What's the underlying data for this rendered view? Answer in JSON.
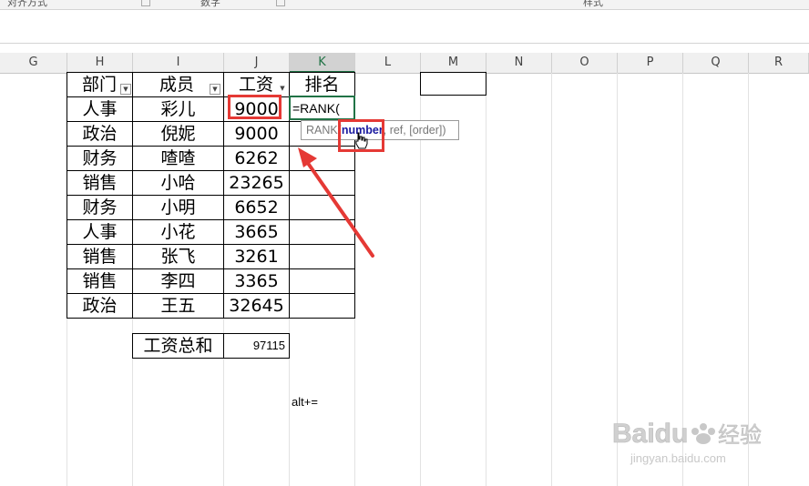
{
  "ribbon": {
    "alignment_label": "对齐方式",
    "number_label": "数字",
    "styles_label": "样式"
  },
  "columns": [
    "G",
    "H",
    "I",
    "J",
    "K",
    "L",
    "M",
    "N",
    "O",
    "P",
    "Q",
    "R"
  ],
  "table": {
    "headers": {
      "dept": "部门",
      "member": "成员",
      "salary": "工资",
      "rank": "排名"
    },
    "rows": [
      {
        "dept": "人事",
        "member": "彩儿",
        "salary": "9000"
      },
      {
        "dept": "政治",
        "member": "倪妮",
        "salary": "9000"
      },
      {
        "dept": "财务",
        "member": "喳喳",
        "salary": "6262"
      },
      {
        "dept": "销售",
        "member": "小哈",
        "salary": "23265"
      },
      {
        "dept": "财务",
        "member": "小明",
        "salary": "6652"
      },
      {
        "dept": "人事",
        "member": "小花",
        "salary": "3665"
      },
      {
        "dept": "销售",
        "member": "张飞",
        "salary": "3261"
      },
      {
        "dept": "销售",
        "member": "李四",
        "salary": "3365"
      },
      {
        "dept": "政治",
        "member": "王五",
        "salary": "32645"
      }
    ]
  },
  "active_cell": {
    "formula": "=RANK("
  },
  "tooltip": {
    "func": "RANK(",
    "arg_active": "number",
    "rest": ", ref, [order])"
  },
  "total": {
    "label": "工资总和",
    "value": "97115"
  },
  "note": "alt+=",
  "watermark": {
    "brand": "Baidu",
    "brand_cn": "经验",
    "url": "jingyan.baidu.com"
  },
  "colors": {
    "accent": "#217346",
    "highlight": "#e53935",
    "tooltip_arg": "#1a1aa0"
  }
}
